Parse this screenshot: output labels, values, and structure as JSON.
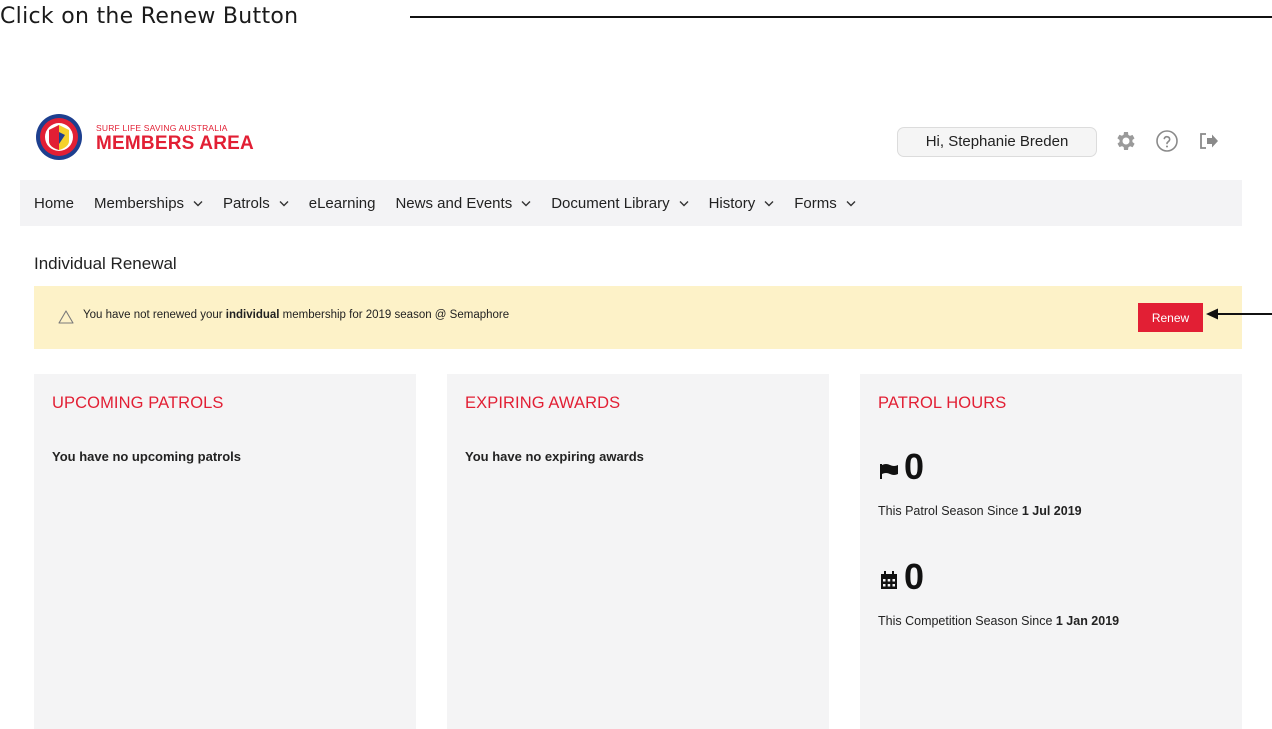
{
  "instruction": {
    "text": "Click on the Renew Button"
  },
  "header": {
    "org_small": "SURF LIFE SAVING AUSTRALIA",
    "app_title": "MEMBERS AREA",
    "greeting": "Hi, Stephanie Breden",
    "icons": [
      "settings-gear-icon",
      "help-circle-icon",
      "logout-icon"
    ]
  },
  "nav": {
    "items": [
      {
        "label": "Home",
        "dropdown": false
      },
      {
        "label": "Memberships",
        "dropdown": true
      },
      {
        "label": "Patrols",
        "dropdown": true
      },
      {
        "label": "eLearning",
        "dropdown": false
      },
      {
        "label": "News and Events",
        "dropdown": true
      },
      {
        "label": "Document Library",
        "dropdown": true
      },
      {
        "label": "History",
        "dropdown": true
      },
      {
        "label": "Forms",
        "dropdown": true
      }
    ]
  },
  "page": {
    "section_title": "Individual Renewal"
  },
  "alert": {
    "text_before": "You have not renewed your ",
    "text_bold": "individual",
    "text_after": " membership for 2019 season @ Semaphore",
    "button_label": "Renew"
  },
  "cards": {
    "upcoming_patrols": {
      "title": "UPCOMING PATROLS",
      "message": "You have no upcoming patrols"
    },
    "expiring_awards": {
      "title": "EXPIRING AWARDS",
      "message": "You have no expiring awards"
    },
    "patrol_hours": {
      "title": "PATROL HOURS",
      "patrol_season_value": "0",
      "patrol_season_caption": "This Patrol Season Since ",
      "patrol_season_date": "1 Jul 2019",
      "competition_season_value": "0",
      "competition_season_caption": "This Competition Season Since ",
      "competition_season_date": "1 Jan 2019"
    }
  },
  "colors": {
    "brand_red": "#e21f34",
    "alert_bg": "#fdf2c8",
    "card_bg": "#f4f4f5",
    "nav_bg": "#f3f3f5"
  }
}
